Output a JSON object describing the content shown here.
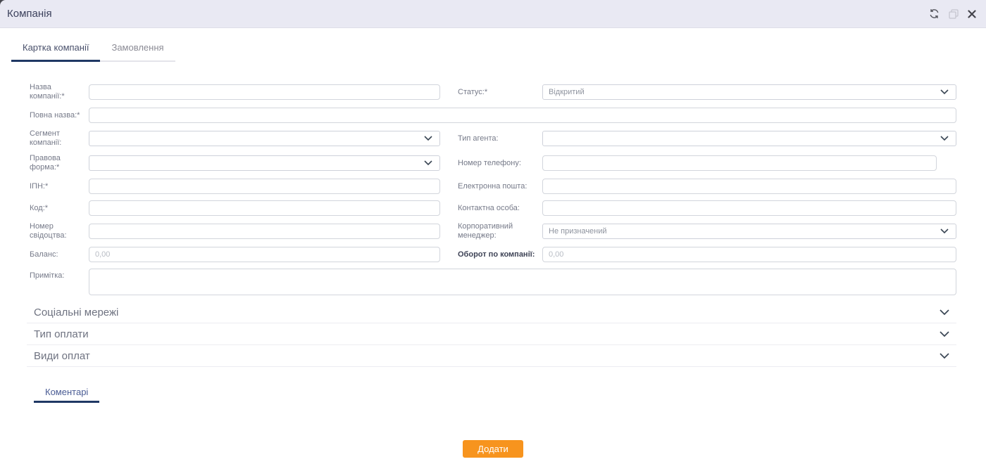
{
  "colors": {
    "header_bg": "#e9e9f3",
    "tab_underline": "#1f3864",
    "accent_orange": "#f7941e",
    "label_grey": "#767a89"
  },
  "window": {
    "title": "Компанія",
    "icons": {
      "refresh": "sync-circular-arrows",
      "restore": "overlapping-squares",
      "close": "x-mark"
    }
  },
  "tabs": {
    "items": [
      {
        "label": "Картка компанії",
        "active": true
      },
      {
        "label": "Замовлення",
        "active": false
      }
    ]
  },
  "form": {
    "fields": {
      "company_name": {
        "label": "Назва компанії:*",
        "value": ""
      },
      "full_name": {
        "label": "Повна назва:*",
        "value": ""
      },
      "segment": {
        "label": "Сегмент компанії:",
        "value": ""
      },
      "legal_form": {
        "label": "Правова форма:*",
        "value": ""
      },
      "ipn": {
        "label": "ІПН:*",
        "value": ""
      },
      "code": {
        "label": "Код:*",
        "value": ""
      },
      "certificate": {
        "label": "Номер свідоцтва:",
        "value": ""
      },
      "balance": {
        "label": "Баланс:",
        "placeholder": "0,00",
        "value": ""
      },
      "note": {
        "label": "Примітка:",
        "value": ""
      },
      "status": {
        "label": "Статус:*",
        "value": "Відкритий"
      },
      "agent_type": {
        "label": "Тип агента:",
        "value": ""
      },
      "phone": {
        "label": "Номер телефону:",
        "value": ""
      },
      "email": {
        "label": "Електронна пошта:",
        "value": ""
      },
      "contact_person": {
        "label": "Контактна особа:",
        "value": ""
      },
      "manager": {
        "label": "Корпоративний менеджер:",
        "value": "Не призначений"
      },
      "turnover": {
        "label": "Оборот по компанії:",
        "placeholder": "0,00",
        "value": ""
      }
    }
  },
  "sections": [
    {
      "label": "Соціальні мережі"
    },
    {
      "label": "Тип оплати"
    },
    {
      "label": "Види оплат"
    }
  ],
  "comments_tab": {
    "label": "Коментарі"
  },
  "actions": {
    "add_label": "Додати"
  }
}
